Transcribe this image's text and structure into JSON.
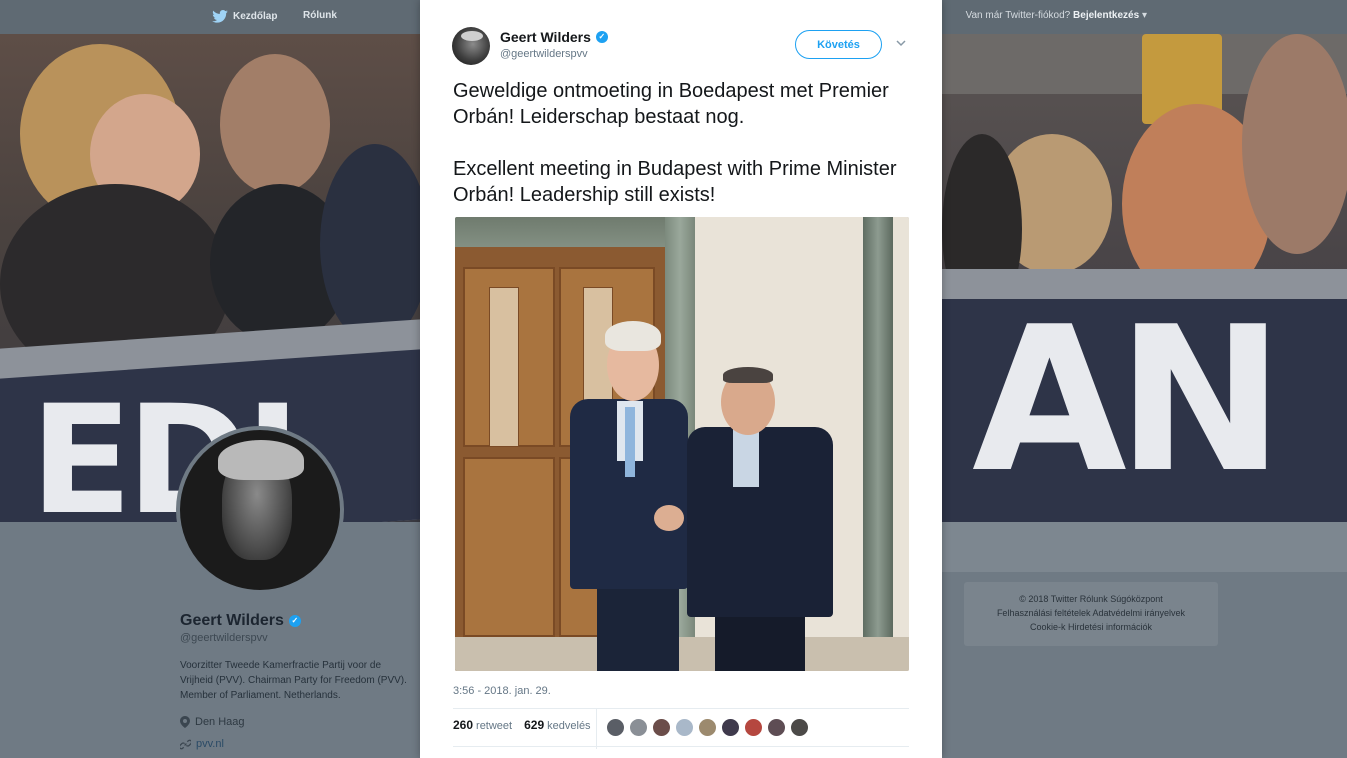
{
  "nav": {
    "home_label": "Kezdőlap",
    "about_label": "Rólunk",
    "account_question": "Van már Twitter-fiókod?",
    "login_label": "Bejelentkezés",
    "login_caret": "▾"
  },
  "profile": {
    "name": "Geert Wilders",
    "handle": "@geertwilderspvv",
    "bio": "Voorzitter Tweede Kamerfractie Partij voor de Vrijheid (PVV). Chairman Party for Freedom (PVV). Member of Parliament. Netherlands.",
    "location": "Den Haag",
    "url": "pvv.nl"
  },
  "footer": {
    "line1": "© 2018 Twitter  Rólunk  Súgóközpont",
    "line2": "Felhasználási feltételek  Adatvédelmi irányelvek",
    "line3": "Cookie-k  Hirdetési információk"
  },
  "tweet": {
    "author_name": "Geert Wilders",
    "author_handle": "@geertwilderspvv",
    "follow_label": "Követés",
    "text_nl": "Geweldige ontmoeting in Boedapest met Premier Orbán! Leiderschap bestaat nog.",
    "text_en": "Excellent meeting in Budapest with Prime Minister Orbán! Leadership still exists!",
    "timestamp": "3:56 - 2018. jan. 29.",
    "retweets": "260",
    "retweets_label": "retweet",
    "likes": "629",
    "likes_label": "kedvelés"
  },
  "colors": {
    "accent": "#1da1f2",
    "verified": "#1da1f2"
  }
}
